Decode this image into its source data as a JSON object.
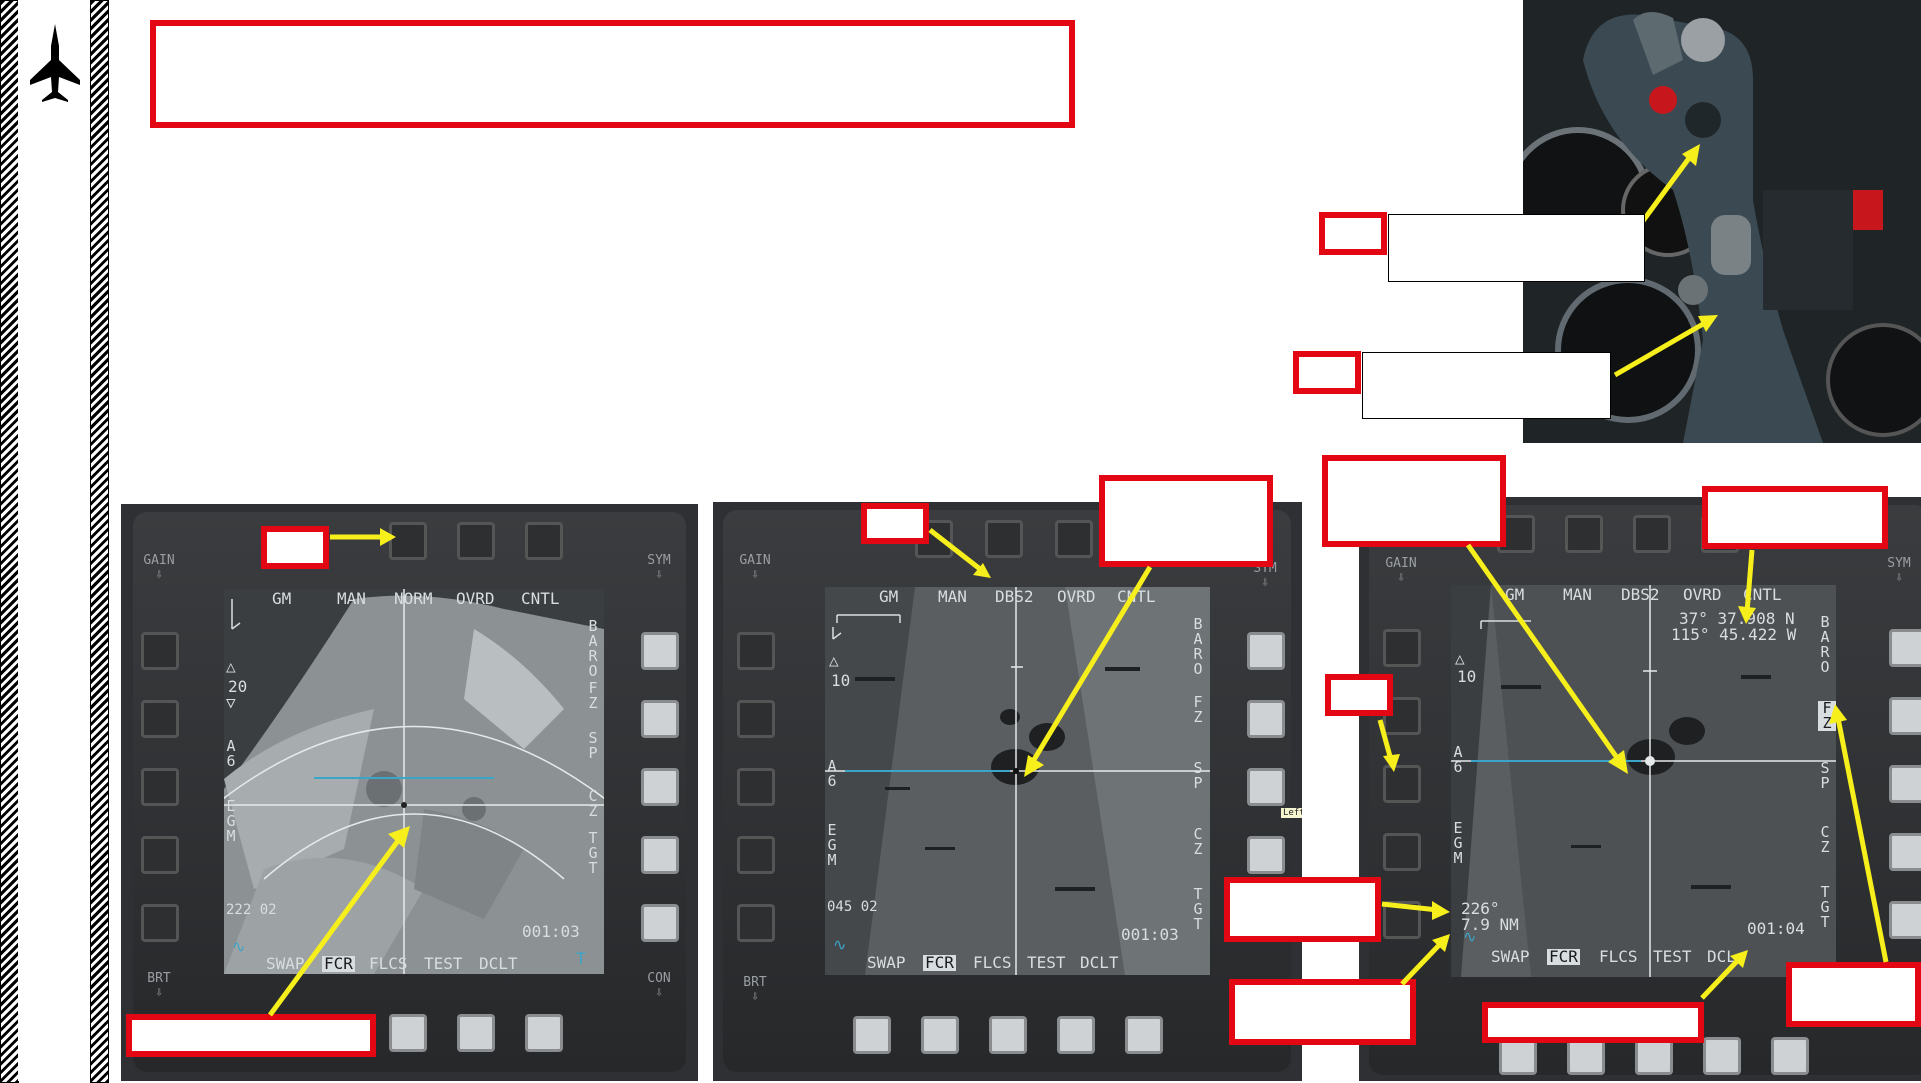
{
  "mfd_left": {
    "top_labels": [
      "GM",
      "MAN",
      "NORM",
      "OVRD",
      "CNTL"
    ],
    "bottom_labels": [
      "SWAP",
      "FCR",
      "FLCS",
      "TEST",
      "DCLT"
    ],
    "right_labels": [
      "BARO",
      "FZ",
      "SP",
      "CZ",
      "TGT"
    ],
    "left_labels": [
      "A 6",
      "EGM"
    ],
    "range": "20",
    "bearing": "222 02",
    "time": "001:03",
    "gain": "GAIN",
    "sym": "SYM",
    "brt": "BRT",
    "con": "CON",
    "tgt_marker": "T"
  },
  "mfd_center": {
    "top_labels": [
      "GM",
      "MAN",
      "DBS2",
      "OVRD",
      "CNTL"
    ],
    "bottom_labels": [
      "SWAP",
      "FCR",
      "FLCS",
      "TEST",
      "DCLT"
    ],
    "right_labels": [
      "BARO",
      "FZ",
      "SP",
      "CZ",
      "TGT"
    ],
    "left_labels": [
      "A 6",
      "EGM"
    ],
    "range": "10",
    "bearing": "045 02",
    "time": "001:03",
    "gain": "GAIN",
    "sym": "SYM",
    "brt": "BRT",
    "tooltip": "Left"
  },
  "mfd_right": {
    "top_labels": [
      "GM",
      "MAN",
      "DBS2",
      "OVRD",
      "CNTL"
    ],
    "bottom_labels": [
      "SWAP",
      "FCR",
      "FLCS",
      "TEST",
      "DCL"
    ],
    "right_labels": [
      "BARO",
      "FZ",
      "SP",
      "CZ",
      "TGT"
    ],
    "left_labels": [
      "A 6",
      "EGM"
    ],
    "range": "10",
    "coord_lat": "37° 37.908 N",
    "coord_lon": "115° 45.422 W",
    "bearing": "226°",
    "distance": "7.9 NM",
    "time": "001:04",
    "gain": "GAIN",
    "sym": "SYM"
  },
  "colors": {
    "callout_red": "#e30613",
    "arrow_yellow": "#f7ef1b"
  }
}
